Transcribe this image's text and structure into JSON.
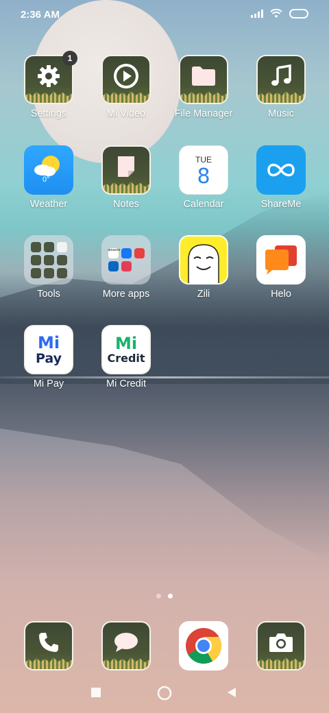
{
  "status_bar": {
    "time": "2:36 AM"
  },
  "apps": [
    {
      "id": "settings",
      "label": "Settings",
      "badge": "1"
    },
    {
      "id": "mi-video",
      "label": "Mi Video"
    },
    {
      "id": "file-manager",
      "label": "File Manager"
    },
    {
      "id": "music",
      "label": "Music"
    },
    {
      "id": "weather",
      "label": "Weather",
      "temp": "0°"
    },
    {
      "id": "notes",
      "label": "Notes"
    },
    {
      "id": "calendar",
      "label": "Calendar",
      "day": "TUE",
      "date": "8"
    },
    {
      "id": "shareme",
      "label": "ShareMe"
    },
    {
      "id": "tools",
      "label": "Tools"
    },
    {
      "id": "more-apps",
      "label": "More apps",
      "mini_text": "amazon"
    },
    {
      "id": "zili",
      "label": "Zili"
    },
    {
      "id": "helo",
      "label": "Helo"
    },
    {
      "id": "mi-pay",
      "label": "Mi Pay",
      "logo_top": "Mi",
      "logo_bottom": "Pay"
    },
    {
      "id": "mi-credit",
      "label": "Mi Credit",
      "logo_top": "Mi",
      "logo_bottom": "Credit"
    }
  ],
  "dock": [
    {
      "id": "phone"
    },
    {
      "id": "messages"
    },
    {
      "id": "chrome"
    },
    {
      "id": "camera"
    }
  ],
  "page_indicator": {
    "pages": 2,
    "current": 2
  },
  "colors": {
    "accent_blue": "#2a86e6",
    "shareme_blue": "#1aa0ef",
    "zili_yellow": "#ffec2a",
    "helo_orange": "#ff7a1a"
  }
}
